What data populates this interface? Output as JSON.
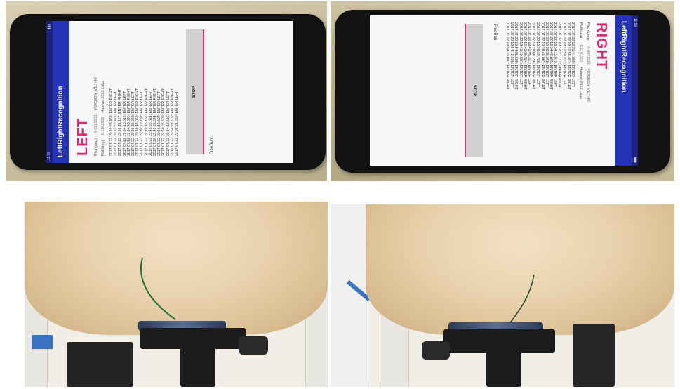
{
  "app": {
    "title": "LeftRightRecognition",
    "status_left": "11:59",
    "status_right": "▮▮▮",
    "version": "VERSION: V1.7.4E",
    "lab": "Huawei 2012 Labs",
    "pitch_label": "Pitch(deg):",
    "roll_label": "Roll(deg):",
    "stop_label": "STOP",
    "freerun_label": "FreeRun"
  },
  "left_screen": {
    "direction": "LEFT",
    "pitch_value": "0.6623513",
    "roll_value": "0.1162919",
    "log": [
      "2017.07.22 19:31:58.453: ENTER RIGHT",
      "2017.07.22 19:31:50.922: ENTER LEFT",
      "2017.07.22 19:32:21.117: ENTER RIGHT",
      "2017.07.22 19:34:15.619: ENTER LEFT",
      "2017.07.22 19:34:40.895: ENTER RIGHT",
      "2017.07.22 19:36:36.268: ENTER LEFT",
      "2017.07.22 19:38:48.062: ENTER RIGHT",
      "2017.07.22 19:39:19.788: ENTER LEFT",
      "2017.07.22 19:39:46.156: ENTER RIGHT",
      "2017.07.22 19:41:05.321: ENTER LEFT",
      "2017.07.22 19:41:06.524: ENTER RIGHT",
      "2017.07.22 19:41:10.507: ENTER LEFT",
      "2017.07.22 19:54:05.509: ENTER RIGHT",
      "2017.07.22 19:54:12.536: ENTER LEFT",
      "2017.07.22 19:54:33.602: ENTER RIGHT",
      "2017.07.22 19:56:21.089: ENTER LEFT"
    ]
  },
  "right_screen": {
    "direction": "RIGHT",
    "pitch_value": "-0.6673111",
    "roll_value": "-0.1191905",
    "log": [
      "2017.07.22 19:31:41.869: ENTER LEFT",
      "2017.07.22 19:31:58.453: ENTER RIGHT",
      "2017.07.22 19:31:50.922: ENTER LEFT",
      "2017.07.22 19:32:21.117: ENTER RIGHT",
      "2017.07.22 19:34:15.619: ENTER LEFT",
      "2017.07.22 19:34:40.895: ENTER RIGHT",
      "2017.07.22 19:36:36.268: ENTER LEFT",
      "2017.07.22 19:38:48.062: ENTER RIGHT",
      "2017.07.22 19:39:19.788: ENTER LEFT",
      "2017.07.22 19:39:46.156: ENTER RIGHT",
      "2017.07.22 19:41:05.321: ENTER LEFT",
      "2017.07.22 19:41:06.524: ENTER RIGHT",
      "2017.07.22 19:41:10.507: ENTER LEFT",
      "2017.07.22 19:54:05.509: ENTER RIGHT",
      "2017.07.22 19:54:12.536: ENTER LEFT",
      "2017.07.22 19:54:33.602: ENTER RIGHT"
    ]
  },
  "colors": {
    "appbar": "#2432b8",
    "accent": "#e8266e",
    "headform_skin": "#e8d1ac"
  }
}
